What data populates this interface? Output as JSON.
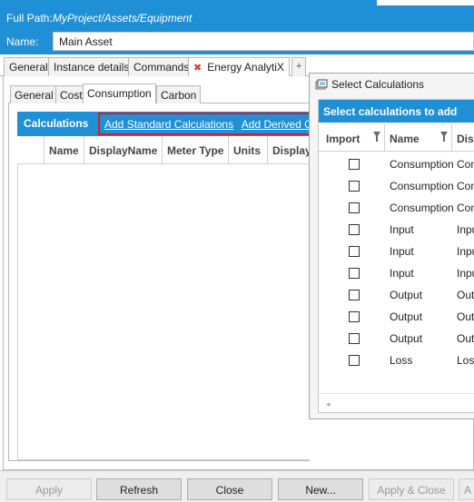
{
  "header": {
    "full_path_label": "Full Path:",
    "full_path_value": "MyProject/Assets/Equipment",
    "name_label": "Name:",
    "name_value": "Main Asset"
  },
  "outer_tabs": [
    {
      "label": "General"
    },
    {
      "label": "Instance details"
    },
    {
      "label": "Commands"
    },
    {
      "label": "Energy AnalytiX",
      "close_icon": "✖"
    },
    {
      "label": "+"
    }
  ],
  "inner_tabs": [
    {
      "label": "General"
    },
    {
      "label": "Cost"
    },
    {
      "label": "Consumption"
    },
    {
      "label": "Carbon"
    }
  ],
  "calculations": {
    "title": "Calculations",
    "link_standard": "Add Standard Calculations",
    "link_derived": "Add Derived Calculations",
    "columns": [
      "Name",
      "DisplayName",
      "Meter Type",
      "Units",
      "Display"
    ]
  },
  "popup": {
    "title": "Select Calculations",
    "bar_title": "Select calculations to add",
    "columns": [
      "Import",
      "Name",
      "Display"
    ],
    "rows": [
      {
        "name": "Consumption",
        "display": "Consumption"
      },
      {
        "name": "Consumption",
        "display": "Consumption"
      },
      {
        "name": "Consumption",
        "display": "Consumption"
      },
      {
        "name": "Input",
        "display": "Input"
      },
      {
        "name": "Input",
        "display": "Input"
      },
      {
        "name": "Input",
        "display": "Input"
      },
      {
        "name": "Output",
        "display": "Output"
      },
      {
        "name": "Output",
        "display": "Output"
      },
      {
        "name": "Output",
        "display": "Output"
      },
      {
        "name": "Loss",
        "display": "Loss"
      }
    ]
  },
  "footer": {
    "apply": "Apply",
    "refresh": "Refresh",
    "close": "Close",
    "new": "New...",
    "apply_close": "Apply & Close",
    "cut_button": "A"
  },
  "colors": {
    "accent": "#1f8fd6",
    "highlight_border": "#d01f26"
  }
}
